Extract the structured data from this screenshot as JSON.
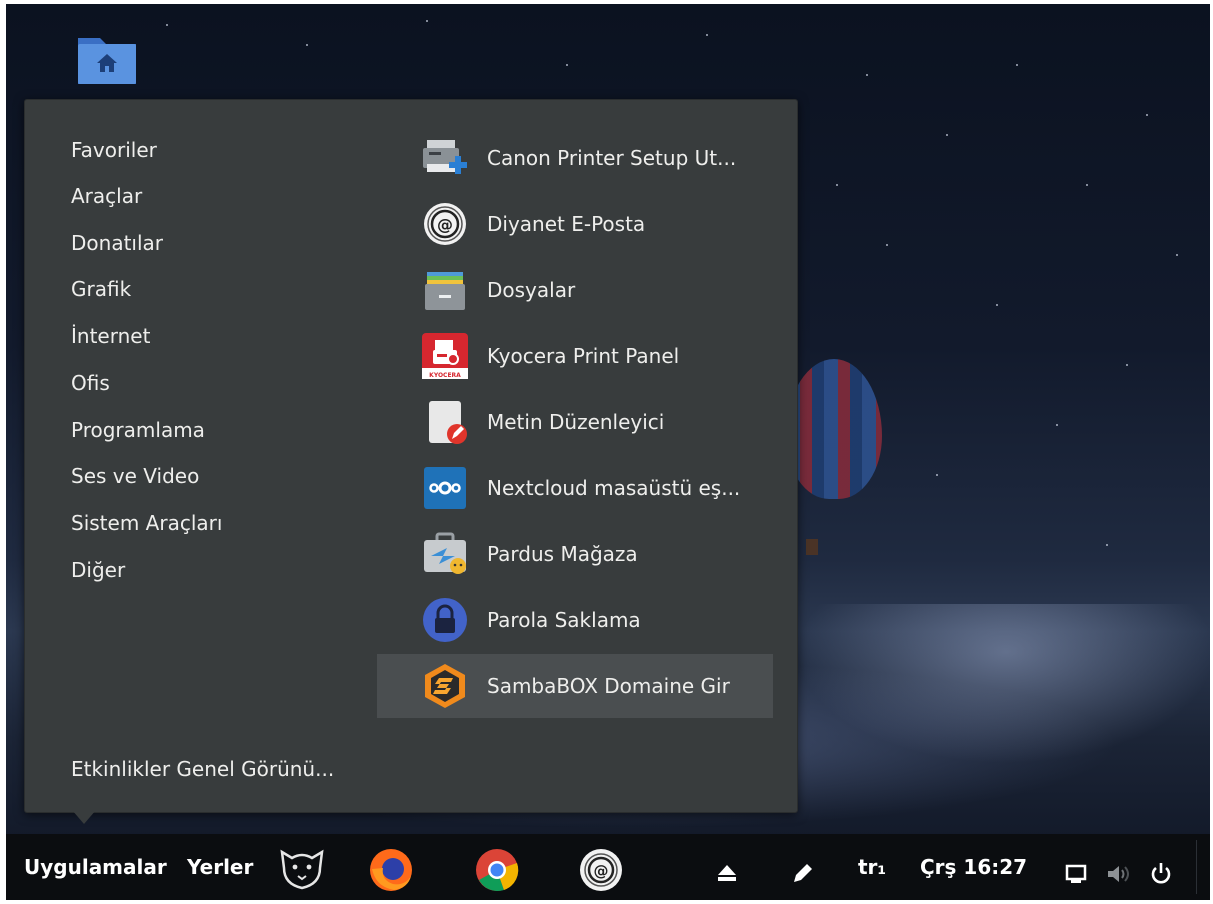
{
  "menu": {
    "categories": [
      "Favoriler",
      "Araçlar",
      "Donatılar",
      "Grafik",
      "İnternet",
      "Ofis",
      "Programlama",
      "Ses ve Video",
      "Sistem Araçları",
      "Diğer"
    ],
    "activities_label": "Etkinlikler Genel Görünü...",
    "apps": [
      {
        "label": "Canon Printer Setup Ut...",
        "icon": "printer-setup-icon"
      },
      {
        "label": "Diyanet E-Posta",
        "icon": "at-sign-mail-icon"
      },
      {
        "label": "Dosyalar",
        "icon": "file-cabinet-icon"
      },
      {
        "label": "Kyocera Print Panel",
        "icon": "kyocera-icon"
      },
      {
        "label": "Metin Düzenleyici",
        "icon": "text-editor-icon"
      },
      {
        "label": "Nextcloud masaüstü eş...",
        "icon": "nextcloud-icon"
      },
      {
        "label": "Pardus Mağaza",
        "icon": "pardus-store-icon"
      },
      {
        "label": "Parola Saklama",
        "icon": "password-lock-icon"
      },
      {
        "label": "SambaBOX Domaine Gir",
        "icon": "sambabox-icon",
        "selected": true
      }
    ]
  },
  "taskbar": {
    "applications_label": "Uygulamalar",
    "places_label": "Yerler",
    "keyboard_layout": "tr₁",
    "clock": "Çrş 16:27",
    "launchers": [
      "pardus-leopard-icon",
      "firefox-icon",
      "chrome-icon",
      "diyanet-mail-icon"
    ],
    "tray": [
      "eject-icon",
      "pencil-icon",
      "screen-icon",
      "volume-icon",
      "power-icon"
    ]
  },
  "colors": {
    "menu_bg": "#383c3d",
    "menu_selected": "#4a4e50",
    "taskbar_bg": "#0b0d10",
    "text": "#eeeeec"
  }
}
